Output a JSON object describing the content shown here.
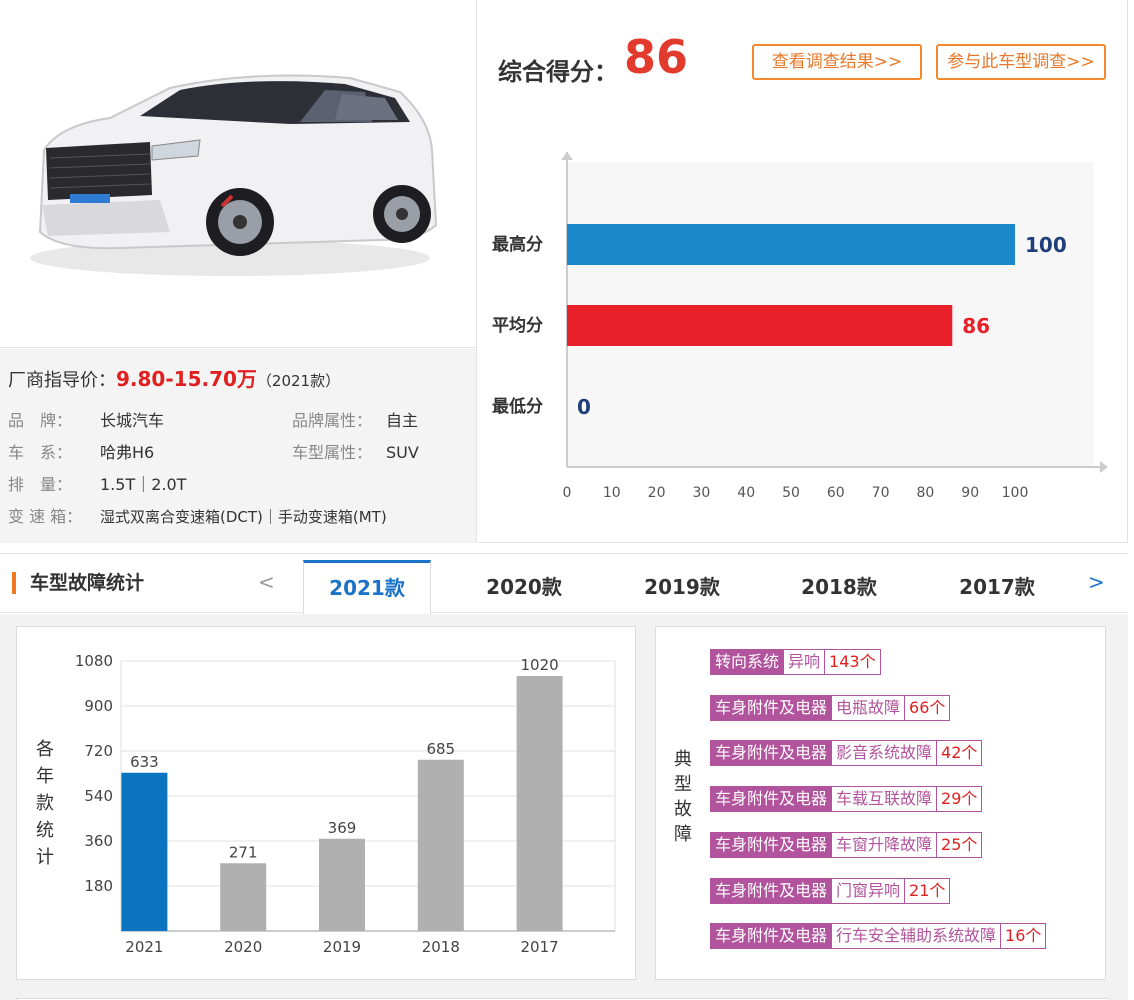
{
  "price": {
    "label": "厂商指导价：",
    "range": "9.80-15.70万",
    "year": "（2021款）"
  },
  "specs": [
    {
      "key": "品　牌：",
      "value": "长城汽车"
    },
    {
      "key": "品牌属性：",
      "value": "自主"
    },
    {
      "key": "车　系：",
      "value": "哈弗H6"
    },
    {
      "key": "车型属性：",
      "value": "SUV"
    },
    {
      "key": "排　量：",
      "value": "1.5T｜2.0T"
    },
    {
      "key": "变 速 箱：",
      "value": "湿式双离合变速箱(DCT)｜手动变速箱(MT)"
    }
  ],
  "score": {
    "title": "综合得分：",
    "value": "86",
    "btn_results": "查看调查结果>>",
    "btn_join": "参与此车型调查>>"
  },
  "chart_data": [
    {
      "type": "bar",
      "orientation": "horizontal",
      "categories": [
        "最高分",
        "平均分",
        "最低分"
      ],
      "values": [
        100,
        86,
        0
      ],
      "colors": [
        "#1a87c9",
        "#e8202a",
        "#1a87c9"
      ],
      "label_colors": [
        "#1f3f77",
        "#e8202a",
        "#1f3f77"
      ],
      "xlim": [
        0,
        100
      ],
      "xticks": [
        "0",
        "10",
        "20",
        "30",
        "40",
        "50",
        "60",
        "70",
        "80",
        "90",
        "100"
      ]
    },
    {
      "type": "bar",
      "categories": [
        "2021",
        "2020",
        "2019",
        "2018",
        "2017"
      ],
      "values": [
        633,
        271,
        369,
        685,
        1020
      ],
      "colors": [
        "#0a74c0",
        "#b0b0b0",
        "#b0b0b0",
        "#b0b0b0",
        "#b0b0b0"
      ],
      "ylabel": "各年款统计",
      "ylim": [
        0,
        1080
      ],
      "yticks": [
        "180",
        "360",
        "540",
        "720",
        "900",
        "1080"
      ]
    }
  ],
  "section": {
    "title": "车型故障统计",
    "prev": "<",
    "next": ">",
    "tabs": [
      "2021款",
      "2020款",
      "2019款",
      "2018款",
      "2017款"
    ],
    "active_tab": "2021款"
  },
  "faults": {
    "label": "典型故障",
    "items": [
      {
        "category": "转向系统",
        "name": "异响",
        "count": "143个"
      },
      {
        "category": "车身附件及电器",
        "name": "电瓶故障",
        "count": "66个"
      },
      {
        "category": "车身附件及电器",
        "name": "影音系统故障",
        "count": "42个"
      },
      {
        "category": "车身附件及电器",
        "name": "车载互联故障",
        "count": "29个"
      },
      {
        "category": "车身附件及电器",
        "name": "车窗升降故障",
        "count": "25个"
      },
      {
        "category": "车身附件及电器",
        "name": "门窗异响",
        "count": "21个"
      },
      {
        "category": "车身附件及电器",
        "name": "行车安全辅助系统故障",
        "count": "16个"
      }
    ]
  },
  "colors": {
    "accent_orange": "#f08a2c",
    "score_red": "#e23b2e",
    "tab_blue": "#1a73c7",
    "fault_purple": "#b2549d"
  }
}
